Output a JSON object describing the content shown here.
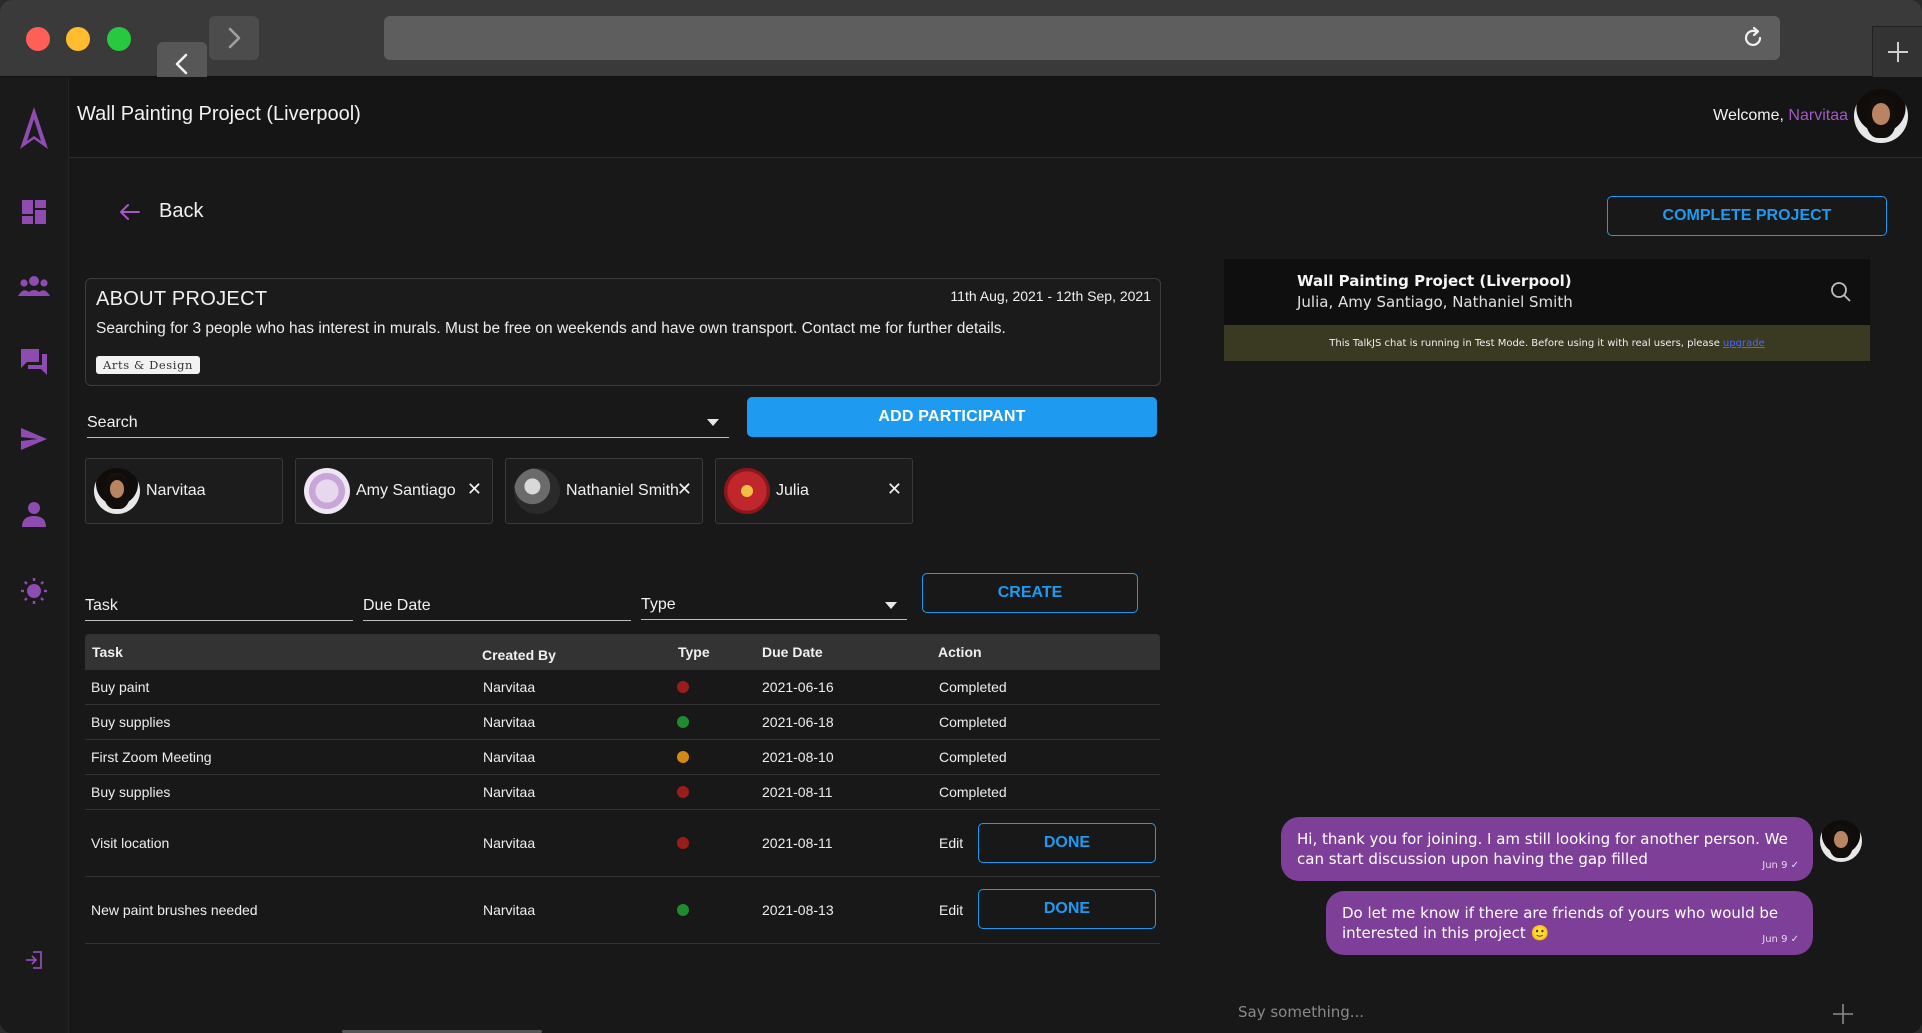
{
  "header": {
    "title": "Wall Painting Project (Liverpool)",
    "welcome_prefix": "Welcome,",
    "username": "Narvitaa"
  },
  "nav": {
    "back_label": "Back",
    "complete_label": "COMPLETE PROJECT"
  },
  "about": {
    "title": "ABOUT PROJECT",
    "dates": "11th Aug, 2021 - 12th Sep, 2021",
    "description": "Searching for 3 people who has interest in murals. Must be free on weekends and have own transport. Contact me for further details.",
    "tag": "Arts & Design"
  },
  "participants": {
    "search_label": "Search",
    "add_label": "ADD PARTICIPANT",
    "people": [
      {
        "name": "Narvitaa"
      },
      {
        "name": "Amy Santiago"
      },
      {
        "name": "Nathaniel Smith"
      },
      {
        "name": "Julia"
      }
    ]
  },
  "task_form": {
    "task_label": "Task",
    "due_label": "Due Date",
    "type_label": "Type",
    "create_label": "CREATE"
  },
  "tasks": {
    "headers": [
      "Task",
      "Created By",
      "Type",
      "Due Date",
      "Action"
    ],
    "rows": [
      {
        "task": "Buy paint",
        "by": "Narvitaa",
        "type_color": "#9b1c1c",
        "due": "2021-06-16",
        "action": "Completed"
      },
      {
        "task": "Buy supplies",
        "by": "Narvitaa",
        "type_color": "#1f8a2e",
        "due": "2021-06-18",
        "action": "Completed"
      },
      {
        "task": "First Zoom Meeting",
        "by": "Narvitaa",
        "type_color": "#d48a12",
        "due": "2021-08-10",
        "action": "Completed"
      },
      {
        "task": "Buy supplies",
        "by": "Narvitaa",
        "type_color": "#9b1c1c",
        "due": "2021-08-11",
        "action": "Completed"
      },
      {
        "task": "Visit location",
        "by": "Narvitaa",
        "type_color": "#9b1c1c",
        "due": "2021-08-11",
        "action": "Edit",
        "done": "DONE"
      },
      {
        "task": "New paint brushes needed",
        "by": "Narvitaa",
        "type_color": "#1f8a2e",
        "due": "2021-08-13",
        "action": "Edit",
        "done": "DONE"
      }
    ]
  },
  "chat": {
    "title": "Wall Painting Project (Liverpool)",
    "members": "Julia, Amy Santiago, Nathaniel Smith",
    "warning": "This TalkJS chat is running in Test Mode. Before using it with real users, please",
    "warning_link": "upgrade",
    "messages": [
      {
        "text": "Hi, thank you for joining. I am still looking for another person. We can start discussion upon having the gap filled",
        "meta": "Jun 9 ✓"
      },
      {
        "text": "Do let me know if there are friends of yours who would be interested in this project 🙂",
        "meta": "Jun 9 ✓"
      }
    ],
    "input_placeholder": "Say something..."
  },
  "colors": {
    "accent_blue": "#1e9bf0",
    "accent_purple": "#a259c4",
    "bubble_purple": "#7d3f97"
  },
  "icons": [
    "logo-icon",
    "dashboard-icon",
    "groups-icon",
    "chat-icon",
    "send-icon",
    "person-icon",
    "brightness-icon",
    "logout-icon",
    "back-arrow-icon",
    "search-icon",
    "reload-icon",
    "plus-icon",
    "close-icon"
  ]
}
